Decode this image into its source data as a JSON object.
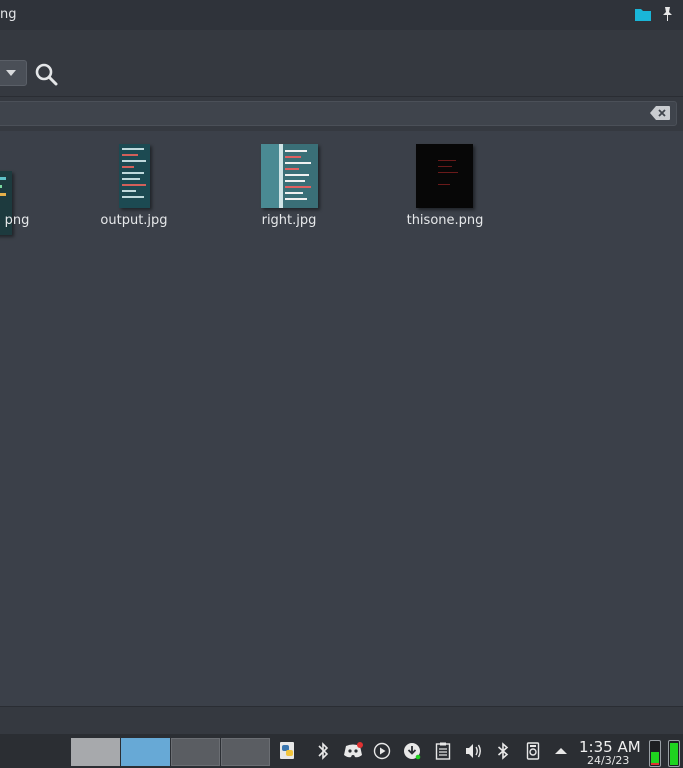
{
  "window": {
    "title_fragment": "ng"
  },
  "files": [
    {
      "name": "png",
      "kind": "partial"
    },
    {
      "name": "output.jpg",
      "kind": "output"
    },
    {
      "name": "right.jpg",
      "kind": "right"
    },
    {
      "name": "thisone.png",
      "kind": "thisone"
    }
  ],
  "taskbar": {
    "clock_time": "1:35 AM",
    "clock_date": "24/3/23",
    "battery_levels": [
      0.62,
      0.98
    ]
  },
  "colors": {
    "accent": "#67a9d6",
    "folder_icon": "#1ab6d8",
    "battery_ok": "#1fd31f",
    "battery_low": "#e03131"
  },
  "tray_icons": [
    "python-icon",
    "kdeconnect-icon",
    "discord-icon",
    "media-play-icon",
    "download-icon",
    "clipboard-icon",
    "volume-icon",
    "bluetooth-icon",
    "device-icon",
    "expand-tray-icon"
  ]
}
